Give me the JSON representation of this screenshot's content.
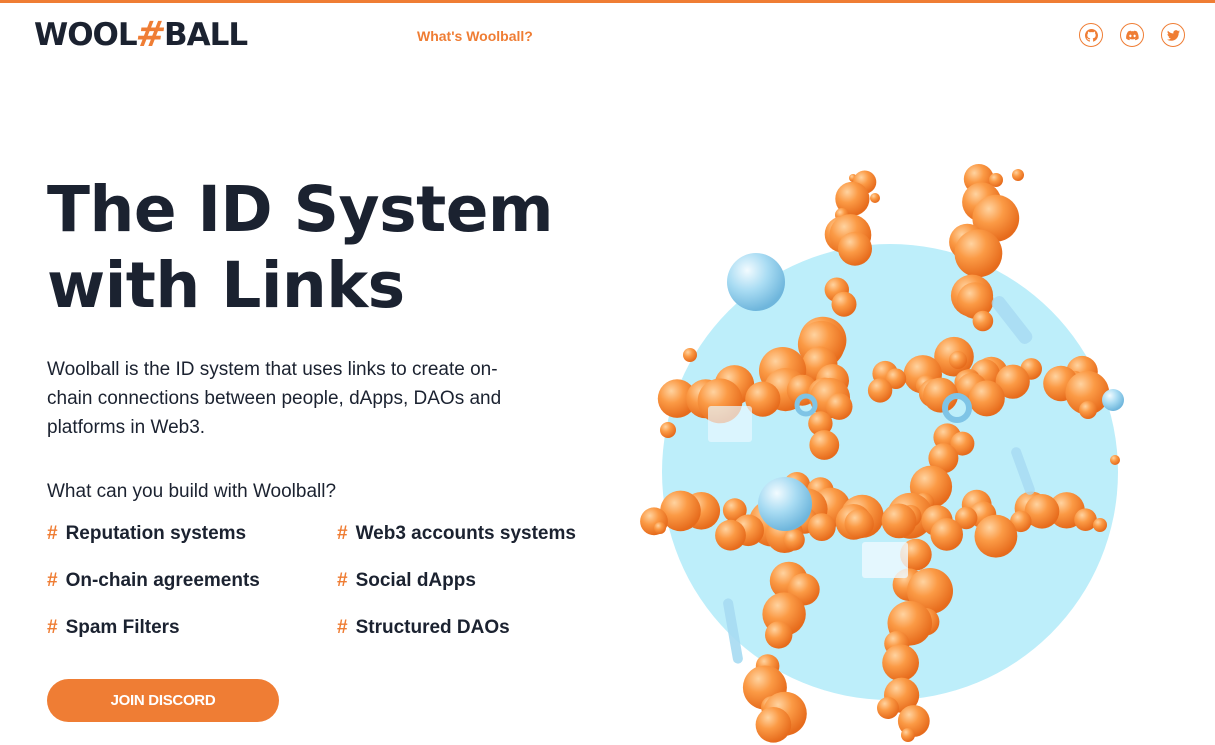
{
  "header": {
    "logo": {
      "part1": "WOOL",
      "hash": "#",
      "part2": "BALL"
    },
    "nav_link": "What's Woolball?",
    "socials": [
      {
        "name": "github",
        "icon": "github-icon"
      },
      {
        "name": "discord",
        "icon": "discord-icon"
      },
      {
        "name": "twitter",
        "icon": "twitter-icon"
      }
    ]
  },
  "hero": {
    "title_line1": "The ID System",
    "title_line2": "with Links",
    "description": "Woolball is the ID system that uses links to create on-chain connections between people, dApps, DAOs and platforms in Web3.",
    "build_question": "What can you build with Woolball?",
    "feature_marker": "#",
    "features": [
      "Reputation systems",
      "Web3 accounts systems",
      "On-chain agreements",
      "Social dApps",
      "Spam Filters",
      "Structured DAOs"
    ],
    "cta_label": "JOIN DISCORD",
    "illustration": "orange-spheres-hashtag-illustration"
  },
  "colors": {
    "accent": "#ef7d34",
    "text": "#1b2230",
    "circle": "#bdeefa",
    "background": "#ffffff"
  }
}
